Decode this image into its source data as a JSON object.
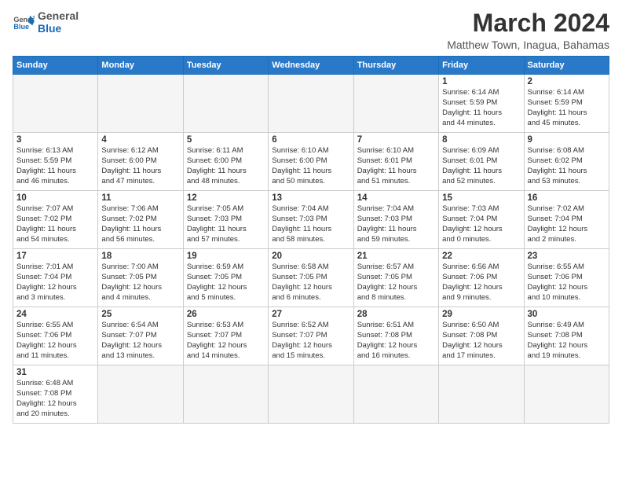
{
  "logo": {
    "text_general": "General",
    "text_blue": "Blue"
  },
  "title": "March 2024",
  "subtitle": "Matthew Town, Inagua, Bahamas",
  "weekdays": [
    "Sunday",
    "Monday",
    "Tuesday",
    "Wednesday",
    "Thursday",
    "Friday",
    "Saturday"
  ],
  "weeks": [
    [
      {
        "day": "",
        "info": ""
      },
      {
        "day": "",
        "info": ""
      },
      {
        "day": "",
        "info": ""
      },
      {
        "day": "",
        "info": ""
      },
      {
        "day": "",
        "info": ""
      },
      {
        "day": "1",
        "info": "Sunrise: 6:14 AM\nSunset: 5:59 PM\nDaylight: 11 hours\nand 44 minutes."
      },
      {
        "day": "2",
        "info": "Sunrise: 6:14 AM\nSunset: 5:59 PM\nDaylight: 11 hours\nand 45 minutes."
      }
    ],
    [
      {
        "day": "3",
        "info": "Sunrise: 6:13 AM\nSunset: 5:59 PM\nDaylight: 11 hours\nand 46 minutes."
      },
      {
        "day": "4",
        "info": "Sunrise: 6:12 AM\nSunset: 6:00 PM\nDaylight: 11 hours\nand 47 minutes."
      },
      {
        "day": "5",
        "info": "Sunrise: 6:11 AM\nSunset: 6:00 PM\nDaylight: 11 hours\nand 48 minutes."
      },
      {
        "day": "6",
        "info": "Sunrise: 6:10 AM\nSunset: 6:00 PM\nDaylight: 11 hours\nand 50 minutes."
      },
      {
        "day": "7",
        "info": "Sunrise: 6:10 AM\nSunset: 6:01 PM\nDaylight: 11 hours\nand 51 minutes."
      },
      {
        "day": "8",
        "info": "Sunrise: 6:09 AM\nSunset: 6:01 PM\nDaylight: 11 hours\nand 52 minutes."
      },
      {
        "day": "9",
        "info": "Sunrise: 6:08 AM\nSunset: 6:02 PM\nDaylight: 11 hours\nand 53 minutes."
      }
    ],
    [
      {
        "day": "10",
        "info": "Sunrise: 7:07 AM\nSunset: 7:02 PM\nDaylight: 11 hours\nand 54 minutes."
      },
      {
        "day": "11",
        "info": "Sunrise: 7:06 AM\nSunset: 7:02 PM\nDaylight: 11 hours\nand 56 minutes."
      },
      {
        "day": "12",
        "info": "Sunrise: 7:05 AM\nSunset: 7:03 PM\nDaylight: 11 hours\nand 57 minutes."
      },
      {
        "day": "13",
        "info": "Sunrise: 7:04 AM\nSunset: 7:03 PM\nDaylight: 11 hours\nand 58 minutes."
      },
      {
        "day": "14",
        "info": "Sunrise: 7:04 AM\nSunset: 7:03 PM\nDaylight: 11 hours\nand 59 minutes."
      },
      {
        "day": "15",
        "info": "Sunrise: 7:03 AM\nSunset: 7:04 PM\nDaylight: 12 hours\nand 0 minutes."
      },
      {
        "day": "16",
        "info": "Sunrise: 7:02 AM\nSunset: 7:04 PM\nDaylight: 12 hours\nand 2 minutes."
      }
    ],
    [
      {
        "day": "17",
        "info": "Sunrise: 7:01 AM\nSunset: 7:04 PM\nDaylight: 12 hours\nand 3 minutes."
      },
      {
        "day": "18",
        "info": "Sunrise: 7:00 AM\nSunset: 7:05 PM\nDaylight: 12 hours\nand 4 minutes."
      },
      {
        "day": "19",
        "info": "Sunrise: 6:59 AM\nSunset: 7:05 PM\nDaylight: 12 hours\nand 5 minutes."
      },
      {
        "day": "20",
        "info": "Sunrise: 6:58 AM\nSunset: 7:05 PM\nDaylight: 12 hours\nand 6 minutes."
      },
      {
        "day": "21",
        "info": "Sunrise: 6:57 AM\nSunset: 7:05 PM\nDaylight: 12 hours\nand 8 minutes."
      },
      {
        "day": "22",
        "info": "Sunrise: 6:56 AM\nSunset: 7:06 PM\nDaylight: 12 hours\nand 9 minutes."
      },
      {
        "day": "23",
        "info": "Sunrise: 6:55 AM\nSunset: 7:06 PM\nDaylight: 12 hours\nand 10 minutes."
      }
    ],
    [
      {
        "day": "24",
        "info": "Sunrise: 6:55 AM\nSunset: 7:06 PM\nDaylight: 12 hours\nand 11 minutes."
      },
      {
        "day": "25",
        "info": "Sunrise: 6:54 AM\nSunset: 7:07 PM\nDaylight: 12 hours\nand 13 minutes."
      },
      {
        "day": "26",
        "info": "Sunrise: 6:53 AM\nSunset: 7:07 PM\nDaylight: 12 hours\nand 14 minutes."
      },
      {
        "day": "27",
        "info": "Sunrise: 6:52 AM\nSunset: 7:07 PM\nDaylight: 12 hours\nand 15 minutes."
      },
      {
        "day": "28",
        "info": "Sunrise: 6:51 AM\nSunset: 7:08 PM\nDaylight: 12 hours\nand 16 minutes."
      },
      {
        "day": "29",
        "info": "Sunrise: 6:50 AM\nSunset: 7:08 PM\nDaylight: 12 hours\nand 17 minutes."
      },
      {
        "day": "30",
        "info": "Sunrise: 6:49 AM\nSunset: 7:08 PM\nDaylight: 12 hours\nand 19 minutes."
      }
    ],
    [
      {
        "day": "31",
        "info": "Sunrise: 6:48 AM\nSunset: 7:08 PM\nDaylight: 12 hours\nand 20 minutes."
      },
      {
        "day": "",
        "info": ""
      },
      {
        "day": "",
        "info": ""
      },
      {
        "day": "",
        "info": ""
      },
      {
        "day": "",
        "info": ""
      },
      {
        "day": "",
        "info": ""
      },
      {
        "day": "",
        "info": ""
      }
    ]
  ]
}
